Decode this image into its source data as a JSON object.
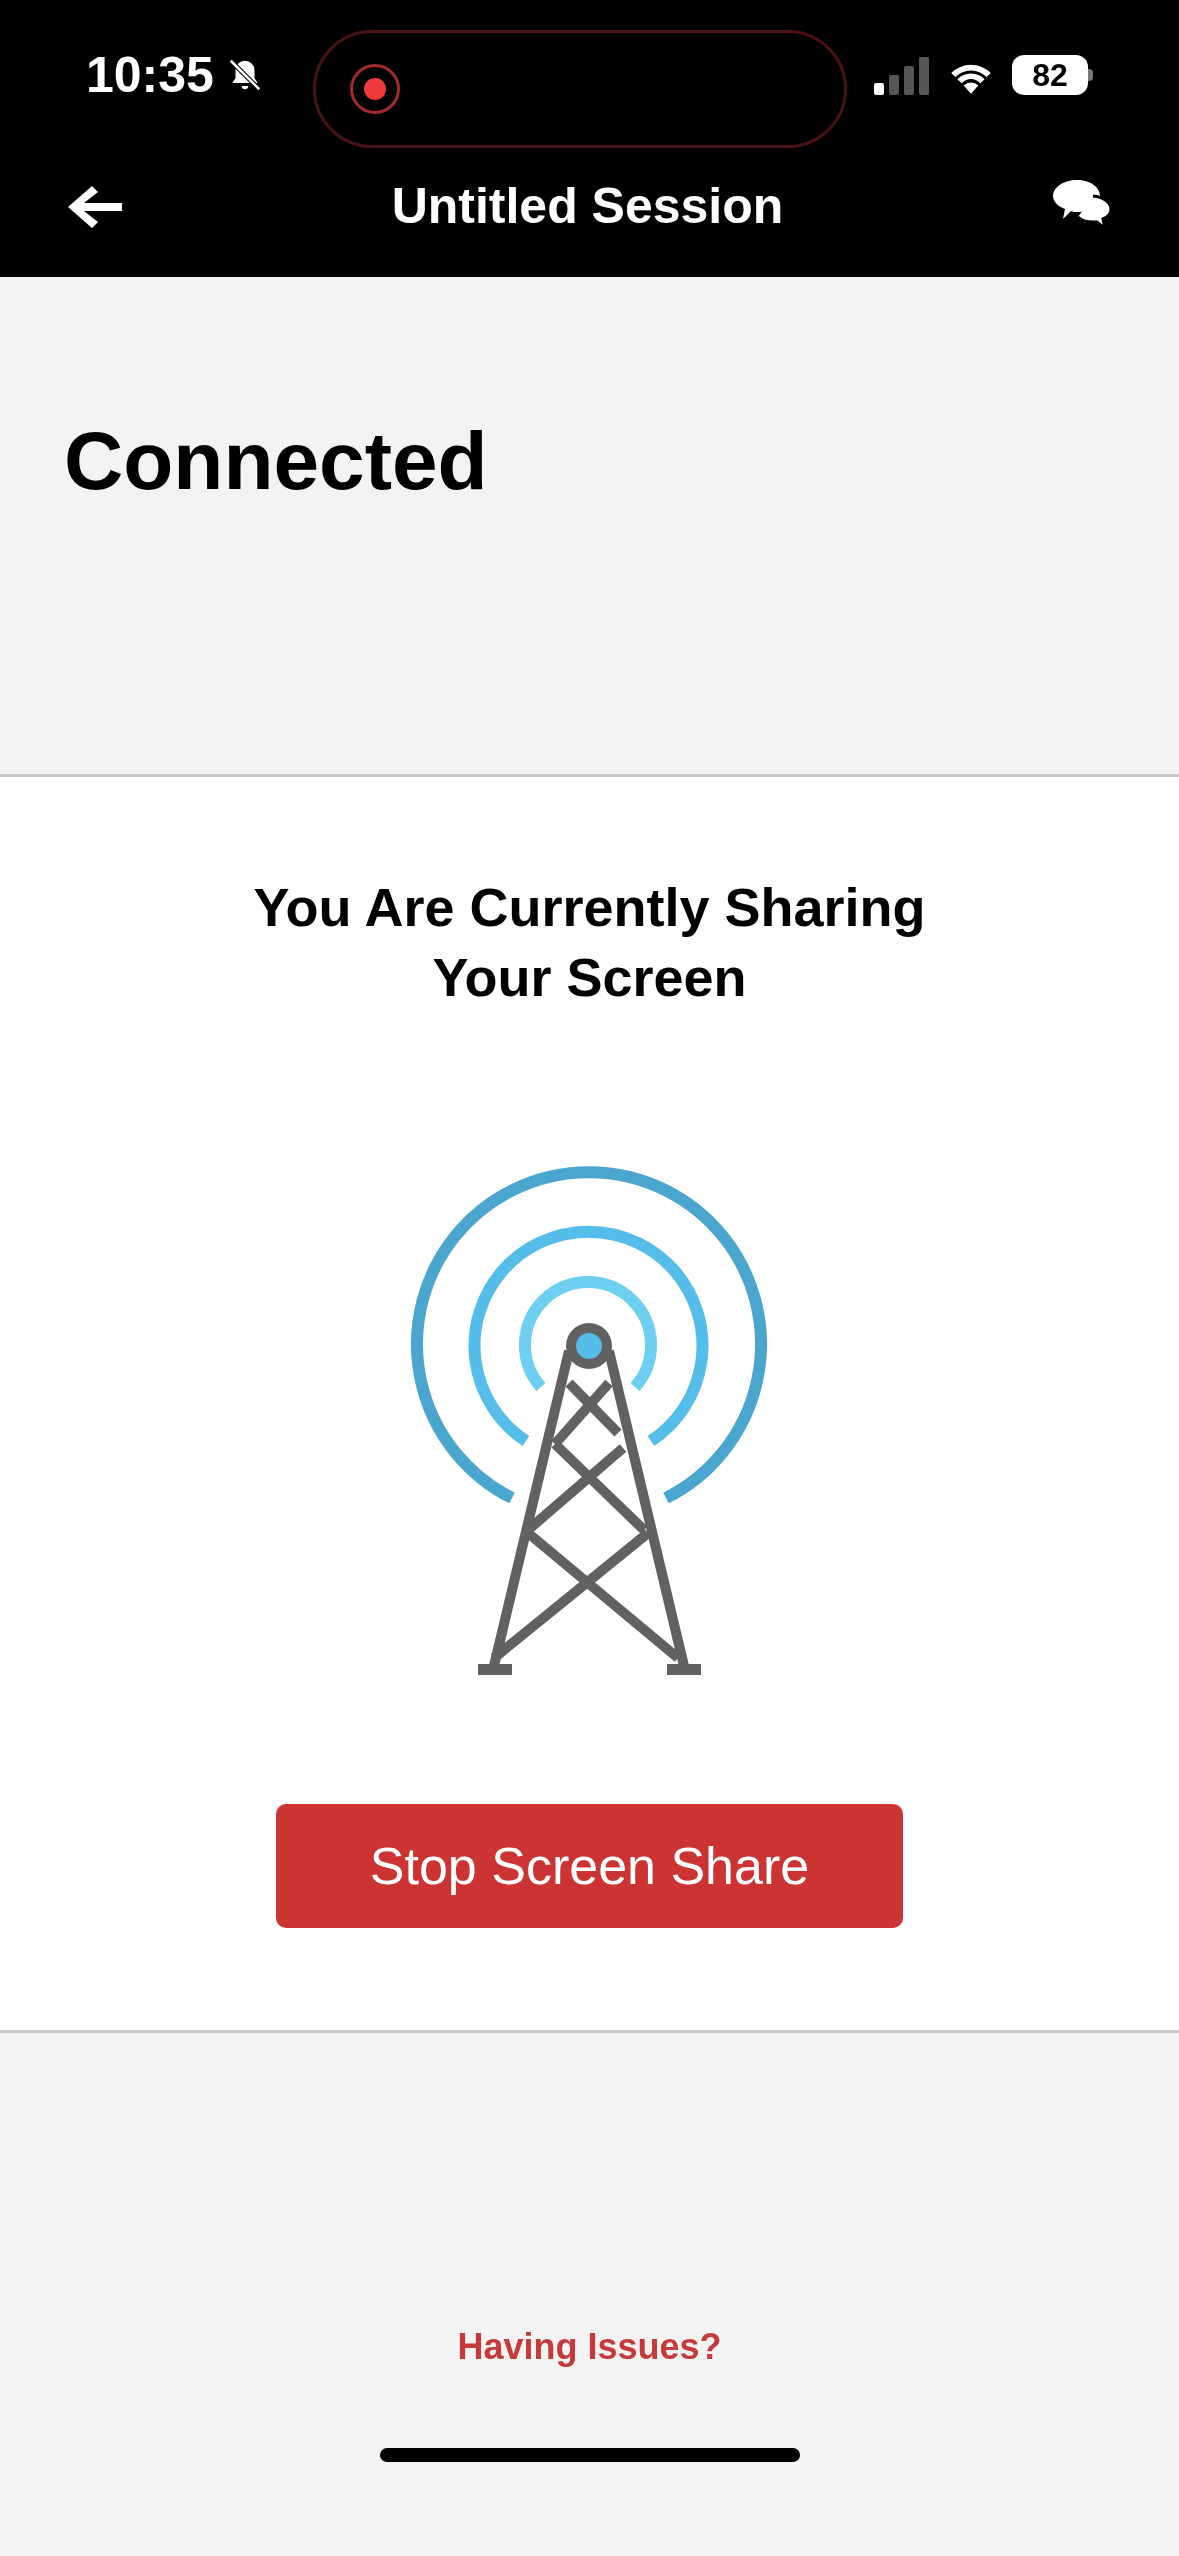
{
  "status_bar": {
    "time": "10:35",
    "battery": "82"
  },
  "nav_bar": {
    "title": "Untitled Session"
  },
  "status": {
    "title": "Connected"
  },
  "sharing": {
    "message": "You Are Currently Sharing Your Screen",
    "button": "Stop Screen Share"
  },
  "footer": {
    "link": "Having Issues?"
  }
}
